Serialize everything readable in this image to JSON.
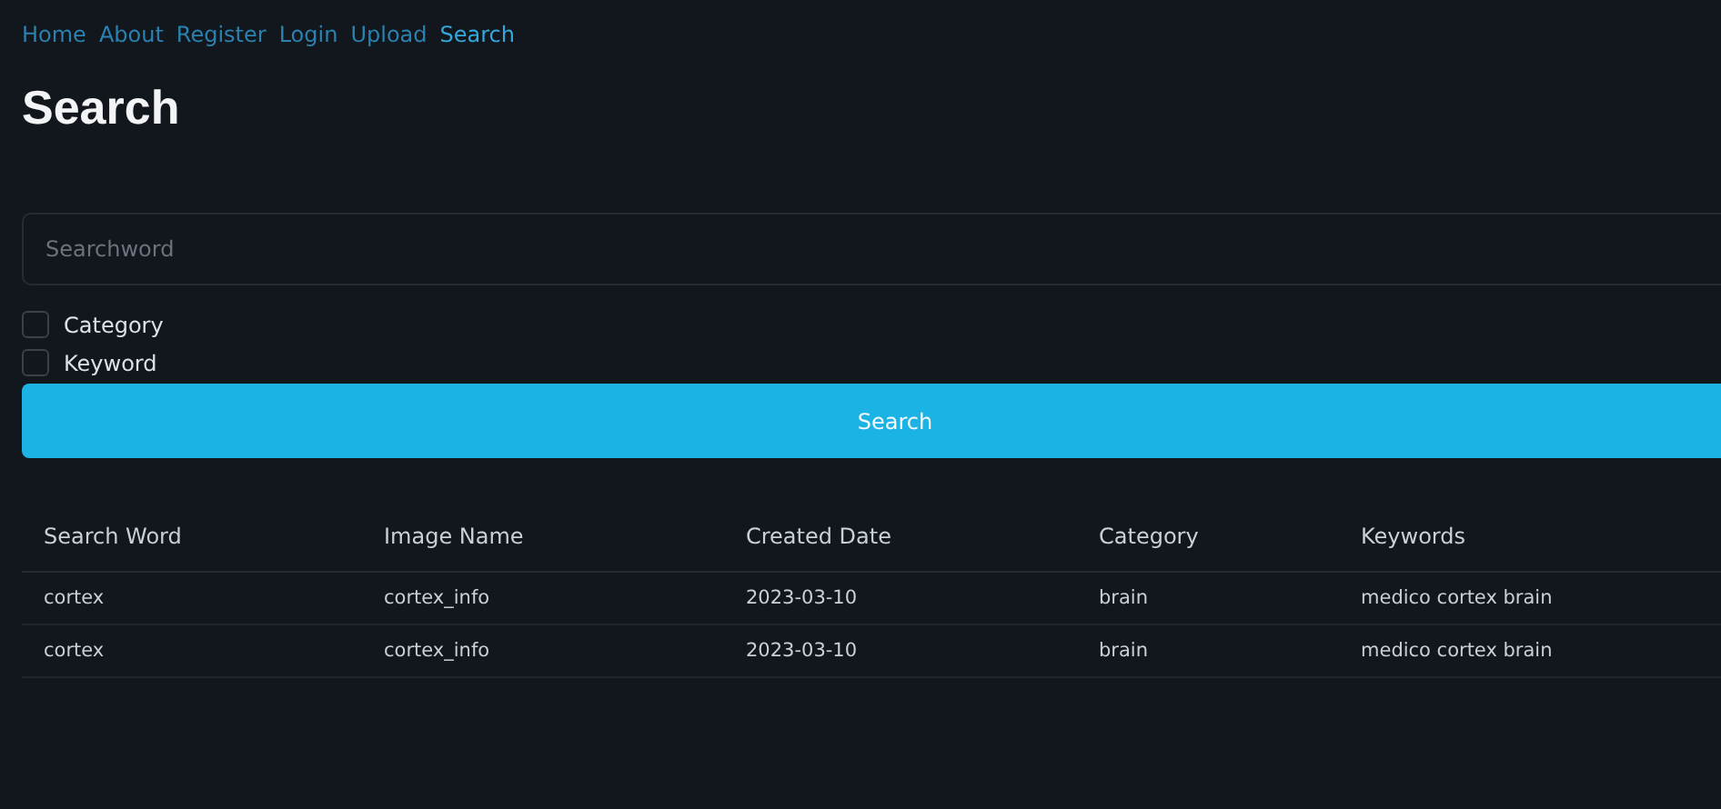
{
  "nav": [
    {
      "label": "Home",
      "selected": false
    },
    {
      "label": "About",
      "selected": false
    },
    {
      "label": "Register",
      "selected": false
    },
    {
      "label": "Login",
      "selected": false
    },
    {
      "label": "Upload",
      "selected": false
    },
    {
      "label": "Search",
      "selected": true
    }
  ],
  "title": "Search",
  "search": {
    "placeholder": "Searchword"
  },
  "filters": [
    {
      "label": "Category",
      "checked": false
    },
    {
      "label": "Keyword",
      "checked": false
    }
  ],
  "button": "Search",
  "table": {
    "columns": [
      "Search Word",
      "Image Name",
      "Created Date",
      "Category",
      "Keywords"
    ],
    "rows": [
      [
        "cortex",
        "cortex_info",
        "2023-03-10",
        "brain",
        "medico cortex brain"
      ],
      [
        "cortex",
        "cortex_info",
        "2023-03-10",
        "brain",
        "medico cortex brain"
      ]
    ]
  }
}
